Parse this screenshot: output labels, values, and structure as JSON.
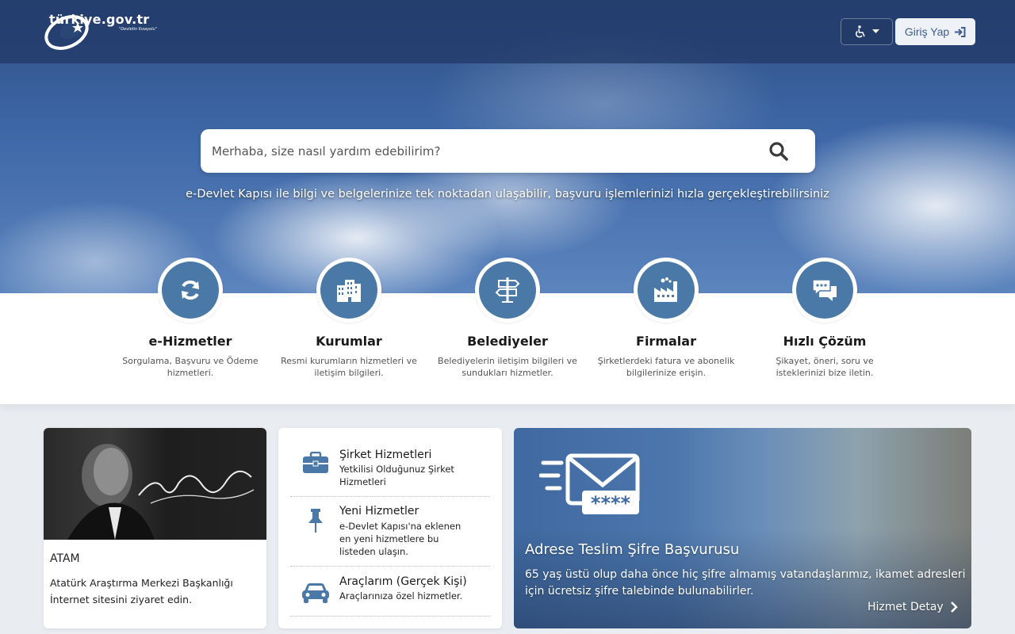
{
  "header": {
    "logo_text": "türkiye.gov.tr",
    "logo_sub": "\"Devletin Kısayolu\"",
    "login_label": "Giriş Yap"
  },
  "search": {
    "placeholder": "Merhaba, size nasıl yardım edebilirim?",
    "tagline": "e-Devlet Kapısı ile bilgi ve belgelerinize tek noktadan ulaşabilir, başvuru işlemlerinizi hızla gerçekleştirebilirsiniz"
  },
  "categories": [
    {
      "title": "e-Hizmetler",
      "desc": "Sorgulama, Başvuru ve Ödeme hizmetleri.",
      "icon": "refresh-icon"
    },
    {
      "title": "Kurumlar",
      "desc": "Resmi kurumların hizmetleri ve iletişim bilgileri.",
      "icon": "building-icon"
    },
    {
      "title": "Belediyeler",
      "desc": "Belediyelerin iletişim bilgileri ve sundukları hizmetler.",
      "icon": "signpost-icon"
    },
    {
      "title": "Firmalar",
      "desc": "Şirketlerdeki fatura ve abonelik bilgilerinize erişin.",
      "icon": "factory-icon"
    },
    {
      "title": "Hızlı Çözüm",
      "desc": "Şikayet, öneri, soru ve isteklerinizi bize iletin.",
      "icon": "chat-icon"
    }
  ],
  "atam": {
    "title": "ATAM",
    "desc": "Atatürk Araştırma Merkezi Başkanlığı İnternet sitesini ziyaret edin."
  },
  "services": [
    {
      "title": "Şirket Hizmetleri",
      "desc": "Yetkilisi Olduğunuz Şirket Hizmetleri",
      "icon": "briefcase-icon"
    },
    {
      "title": "Yeni Hizmetler",
      "desc": "e-Devlet Kapısı'na eklenen en yeni hizmetlere bu listeden ulaşın.",
      "icon": "pushpin-icon"
    },
    {
      "title": "Araçlarım (Gerçek Kişi)",
      "desc": "Araçlarınıza özel hizmetler.",
      "icon": "car-icon"
    }
  ],
  "promo": {
    "title": "Adrese Teslim Şifre Başvurusu",
    "desc": "65 yaş üstü olup daha önce hiç şifre almamış vatandaşlarımız, ikamet adresleri için ücretsiz şifre talebinde bulunabilirler.",
    "link": "Hizmet Detay",
    "envelope_code": "****"
  },
  "colors": {
    "accent": "#4a79a8",
    "header_bg": "#243c6a",
    "login_text": "#3c5d8e"
  }
}
